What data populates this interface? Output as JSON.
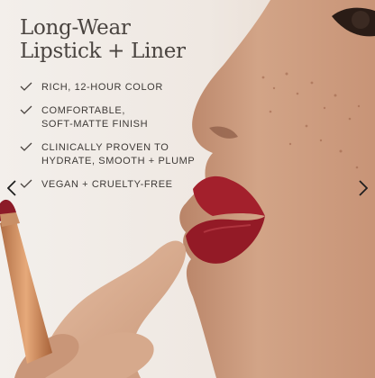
{
  "carousel": {
    "headline": [
      "Long-Wear",
      "Lipstick + Liner"
    ],
    "features": [
      "RICH, 12-HOUR COLOR",
      "COMFORTABLE,\nSOFT-MATTE FINISH",
      "CLINICALLY PROVEN TO\nHYDRATE, SMOOTH + PLUMP",
      "VEGAN + CRUELTY-FREE"
    ],
    "icons": {
      "check": "check-icon",
      "prev": "chevron-left-icon",
      "next": "chevron-right-icon"
    },
    "colors": {
      "background": "#efe9e4",
      "text": "#3e3a37",
      "skin": "#c99a7e",
      "lip": "#a3202c"
    }
  }
}
